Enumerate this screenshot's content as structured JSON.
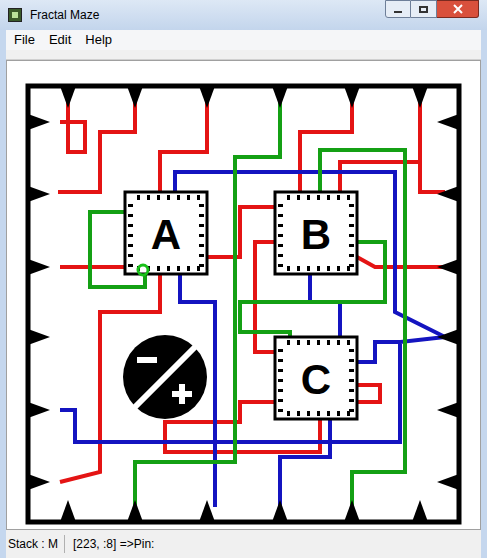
{
  "window": {
    "title": "Fractal Maze"
  },
  "menu": [
    "File",
    "Edit",
    "Help"
  ],
  "maze": {
    "chips": [
      {
        "label": "A"
      },
      {
        "label": "B"
      },
      {
        "label": "C"
      }
    ],
    "marker": {
      "visible": true
    }
  },
  "status_bar": {
    "stack": "Stack : M",
    "position": "[223, :8] =>Pin:"
  }
}
